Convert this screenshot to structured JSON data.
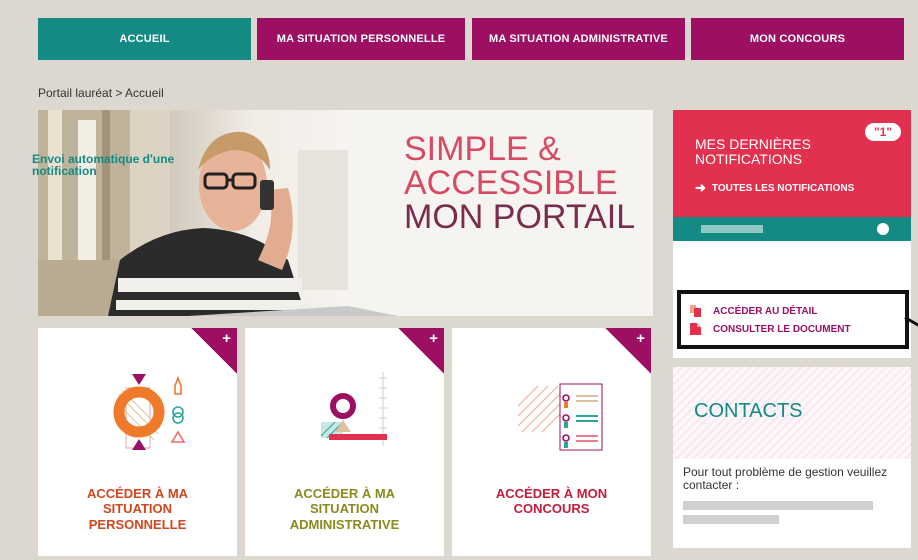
{
  "nav": {
    "items": [
      {
        "label": "ACCUEIL"
      },
      {
        "label": "MA SITUATION PERSONNELLE"
      },
      {
        "label": "MA SITUATION ADMINISTRATIVE"
      },
      {
        "label": "MON CONCOURS"
      }
    ]
  },
  "breadcrumb": "Portail lauréat > Accueil",
  "hero": {
    "line1": "SIMPLE &",
    "line2": "ACCESSIBLE",
    "line3": "MON PORTAIL"
  },
  "tiles": [
    {
      "label": "ACCÉDER À MA\nSITUATION\nPERSONNELLE",
      "plus": "+",
      "icon": "personal-situation-icon"
    },
    {
      "label": "ACCÉDER À MA\nSITUATION\nADMINISTRATIVE",
      "plus": "+",
      "icon": "administrative-situation-icon"
    },
    {
      "label": "ACCÉDER À MON\nCONCOURS",
      "plus": "+",
      "icon": "contest-icon"
    }
  ],
  "notifications": {
    "title": "MES DERNIÈRES NOTIFICATIONS",
    "badge": "\"1\"",
    "all_link": "TOUTES LES NOTIFICATIONS",
    "message": "Envoi automatique d'une notification",
    "actions": [
      {
        "label": "ACCÉDER AU DÉTAIL",
        "icon": "copy-icon"
      },
      {
        "label": "CONSULTER LE DOCUMENT",
        "icon": "document-icon"
      }
    ]
  },
  "contacts": {
    "title": "CONTACTS",
    "text": "Pour tout problème de gestion veuillez contacter :"
  },
  "colors": {
    "teal": "#138a84",
    "purple": "#9c0f62",
    "red": "#e2304f",
    "background": "#ddd8cf"
  }
}
